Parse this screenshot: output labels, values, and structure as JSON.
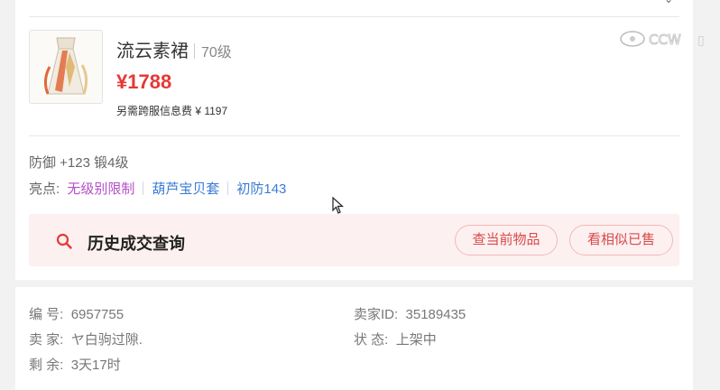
{
  "item": {
    "name": "流云素裙",
    "level": "70级",
    "price": "¥1788",
    "fee": "另需跨服信息费 ¥ 1197",
    "defense": "防御 +123 锻4级",
    "highlights_label": "亮点:",
    "highlights": [
      {
        "text": "无级别限制",
        "color": "#b44fc8"
      },
      {
        "text": "葫芦宝贝套",
        "color": "#3a7bd5"
      },
      {
        "text": "初防143",
        "color": "#3a7bd5"
      }
    ]
  },
  "history": {
    "title": "历史成交查询",
    "btn_current": "查当前物品",
    "btn_similar": "看相似已售"
  },
  "info": {
    "number_label": "编 号:",
    "number_value": "6957755",
    "seller_id_label": "卖家ID:",
    "seller_id_value": "35189435",
    "seller_label": "卖 家:",
    "seller_value": "ヤ白驹过隙.",
    "status_label": "状 态:",
    "status_value": "上架中",
    "remaining_label": "剩 余:",
    "remaining_value": "3天17时"
  },
  "colors": {
    "accent": "#e53935",
    "link_blue": "#3a7bd5",
    "link_purple": "#b44fc8",
    "history_bg": "#fdf0f0"
  }
}
